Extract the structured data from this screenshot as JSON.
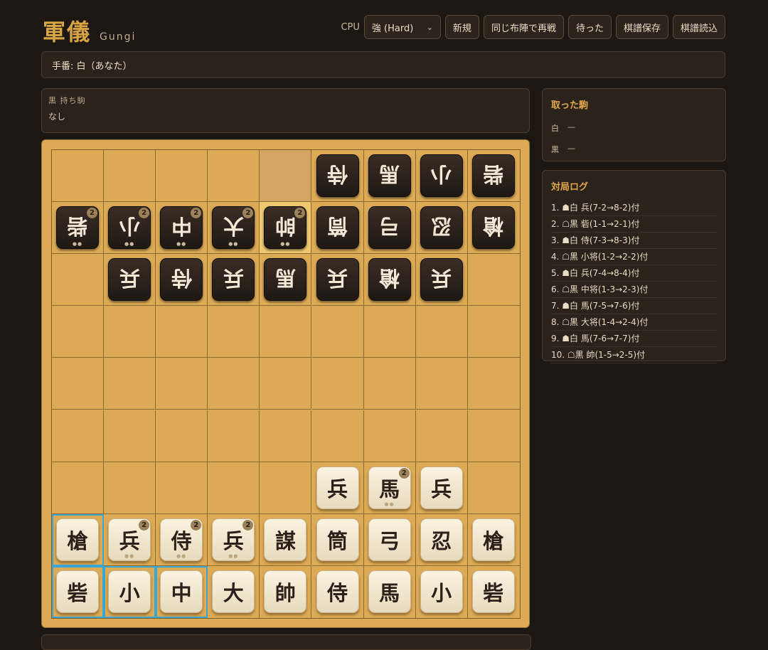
{
  "header": {
    "title": "軍儀",
    "subtitle": "Gungi"
  },
  "toolbar": {
    "cpu_label": "CPU",
    "cpu_select_value": "強 (Hard)",
    "buttons": [
      "新規",
      "同じ布陣で再戦",
      "待った",
      "棋譜保存",
      "棋譜読込"
    ]
  },
  "turn": {
    "text": "手番: 白（あなた）"
  },
  "black_hand": {
    "title": "黒 持ち駒",
    "value": "なし"
  },
  "captured": {
    "title": "取った駒",
    "white_label": "白",
    "white_value": "—",
    "black_label": "黒",
    "black_value": "—"
  },
  "log": {
    "title": "対局ログ",
    "items": [
      "1. ☗白 兵(7-2→8-2)付",
      "2. ☖黒 砦(1-1→2-1)付",
      "3. ☗白 侍(7-3→8-3)付",
      "4. ☖黒 小将(1-2→2-2)付",
      "5. ☗白 兵(7-4→8-4)付",
      "6. ☖黒 中将(1-3→2-3)付",
      "7. ☗白 馬(7-5→7-6)付",
      "8. ☖黒 大将(1-4→2-4)付",
      "9. ☗白 馬(7-6→7-7)付",
      "10. ☖黒 帥(1-5→2-5)付"
    ]
  },
  "board": {
    "size": 9,
    "highlight_cells": [
      [
        0,
        4
      ]
    ],
    "last_move_cells": [
      [
        1,
        4
      ]
    ],
    "selected_cells": [
      [
        7,
        0
      ],
      [
        8,
        0
      ],
      [
        8,
        1
      ],
      [
        8,
        2
      ]
    ],
    "pieces": [
      {
        "r": 0,
        "c": 5,
        "ch": "侍",
        "side": "b"
      },
      {
        "r": 0,
        "c": 6,
        "ch": "馬",
        "side": "b"
      },
      {
        "r": 0,
        "c": 7,
        "ch": "小",
        "side": "b"
      },
      {
        "r": 0,
        "c": 8,
        "ch": "砦",
        "side": "b"
      },
      {
        "r": 1,
        "c": 0,
        "ch": "砦",
        "side": "b",
        "stack": "2",
        "dots": true
      },
      {
        "r": 1,
        "c": 1,
        "ch": "小",
        "side": "b",
        "stack": "2",
        "dots": true
      },
      {
        "r": 1,
        "c": 2,
        "ch": "中",
        "side": "b",
        "stack": "2",
        "dots": true
      },
      {
        "r": 1,
        "c": 3,
        "ch": "大",
        "side": "b",
        "stack": "2",
        "dots": true
      },
      {
        "r": 1,
        "c": 4,
        "ch": "帥",
        "side": "b",
        "stack": "2",
        "dots": true
      },
      {
        "r": 1,
        "c": 5,
        "ch": "筒",
        "side": "b"
      },
      {
        "r": 1,
        "c": 6,
        "ch": "弓",
        "side": "b"
      },
      {
        "r": 1,
        "c": 7,
        "ch": "忍",
        "side": "b"
      },
      {
        "r": 1,
        "c": 8,
        "ch": "槍",
        "side": "b"
      },
      {
        "r": 2,
        "c": 1,
        "ch": "兵",
        "side": "b"
      },
      {
        "r": 2,
        "c": 2,
        "ch": "侍",
        "side": "b"
      },
      {
        "r": 2,
        "c": 3,
        "ch": "兵",
        "side": "b"
      },
      {
        "r": 2,
        "c": 4,
        "ch": "馬",
        "side": "b"
      },
      {
        "r": 2,
        "c": 5,
        "ch": "兵",
        "side": "b"
      },
      {
        "r": 2,
        "c": 6,
        "ch": "槍",
        "side": "b"
      },
      {
        "r": 2,
        "c": 7,
        "ch": "兵",
        "side": "b"
      },
      {
        "r": 6,
        "c": 5,
        "ch": "兵",
        "side": "w"
      },
      {
        "r": 6,
        "c": 6,
        "ch": "馬",
        "side": "w",
        "stack": "2",
        "dots": true
      },
      {
        "r": 6,
        "c": 7,
        "ch": "兵",
        "side": "w"
      },
      {
        "r": 7,
        "c": 0,
        "ch": "槍",
        "side": "w"
      },
      {
        "r": 7,
        "c": 1,
        "ch": "兵",
        "side": "w",
        "stack": "2",
        "dots": true
      },
      {
        "r": 7,
        "c": 2,
        "ch": "侍",
        "side": "w",
        "stack": "2",
        "dots": true
      },
      {
        "r": 7,
        "c": 3,
        "ch": "兵",
        "side": "w",
        "stack": "2",
        "dots": true
      },
      {
        "r": 7,
        "c": 4,
        "ch": "謀",
        "side": "w"
      },
      {
        "r": 7,
        "c": 5,
        "ch": "筒",
        "side": "w"
      },
      {
        "r": 7,
        "c": 6,
        "ch": "弓",
        "side": "w"
      },
      {
        "r": 7,
        "c": 7,
        "ch": "忍",
        "side": "w"
      },
      {
        "r": 7,
        "c": 8,
        "ch": "槍",
        "side": "w"
      },
      {
        "r": 8,
        "c": 0,
        "ch": "砦",
        "side": "w"
      },
      {
        "r": 8,
        "c": 1,
        "ch": "小",
        "side": "w"
      },
      {
        "r": 8,
        "c": 2,
        "ch": "中",
        "side": "w"
      },
      {
        "r": 8,
        "c": 3,
        "ch": "大",
        "side": "w"
      },
      {
        "r": 8,
        "c": 4,
        "ch": "帥",
        "side": "w"
      },
      {
        "r": 8,
        "c": 5,
        "ch": "侍",
        "side": "w"
      },
      {
        "r": 8,
        "c": 6,
        "ch": "馬",
        "side": "w"
      },
      {
        "r": 8,
        "c": 7,
        "ch": "小",
        "side": "w"
      },
      {
        "r": 8,
        "c": 8,
        "ch": "砦",
        "side": "w"
      }
    ]
  },
  "colors": {
    "accent": "#d9a544",
    "board": "#dcaa55",
    "select": "#38a7d6"
  }
}
